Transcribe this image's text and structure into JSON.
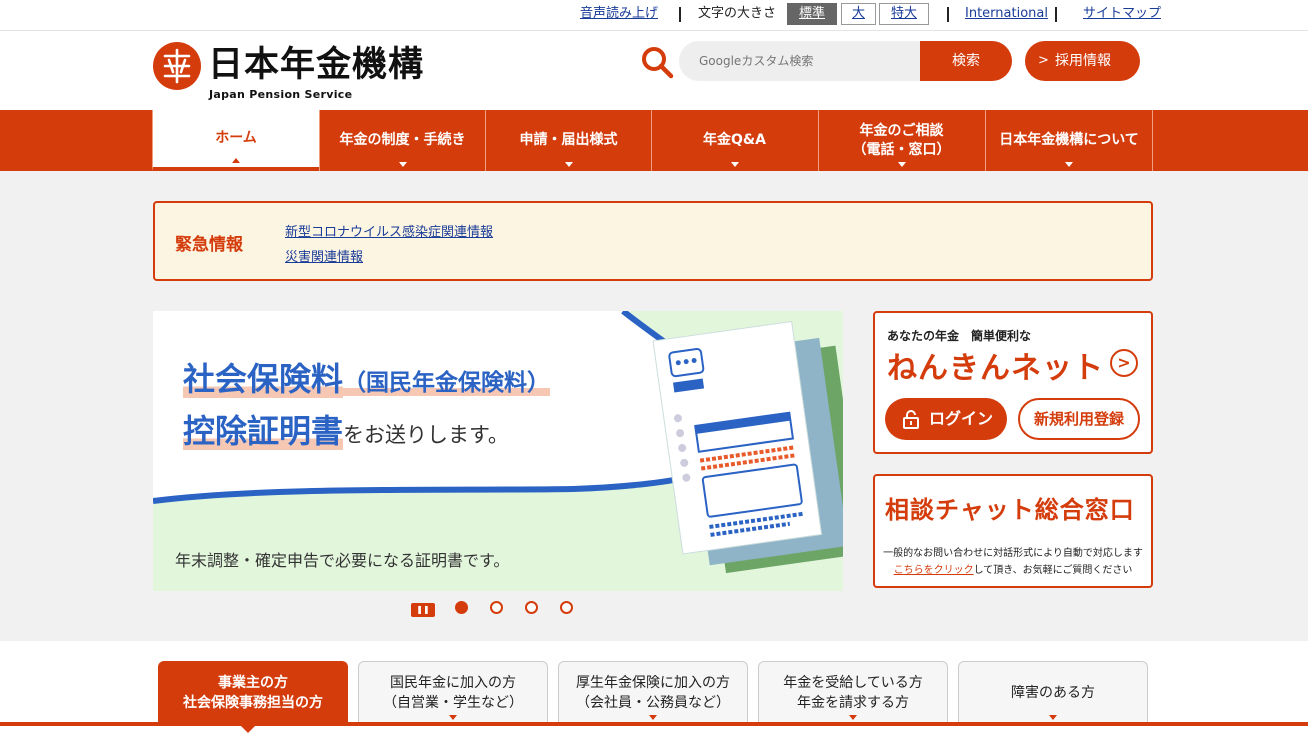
{
  "utility": {
    "voice": "音声読み上げ",
    "font_size_label": "文字の大きさ",
    "font_sizes": [
      "標準",
      "大",
      "特大"
    ],
    "international": "International",
    "sitemap": "サイトマップ"
  },
  "header": {
    "logo_text": "日本年金機構",
    "logo_sub": "Japan Pension Service",
    "search_placeholder": "Googleカスタム検索",
    "search_button": "検索",
    "recruit_button": "採用情報"
  },
  "nav": [
    {
      "label": "ホーム"
    },
    {
      "label": "年金の制度・手続き"
    },
    {
      "label": "申請・届出様式"
    },
    {
      "label": "年金Q&A"
    },
    {
      "label": "年金のご相談\n（電話・窓口）"
    },
    {
      "label": "日本年金機構について"
    }
  ],
  "alert": {
    "title": "緊急情報",
    "links": [
      "新型コロナウイルス感染症関連情報",
      "災害関連情報"
    ]
  },
  "banner": {
    "line1_main": "社会保険料",
    "line1_paren": "（国民年金保険料）",
    "line2_main": "控除証明書",
    "line2_tail": "をお送りします。",
    "footer": "年末調整・確定申告で必要になる証明書です。",
    "slides_total": 4,
    "slide_active": 1
  },
  "nenkin_net": {
    "subtitle": "あなたの年金　簡単便利な",
    "title": "ねんきんネット",
    "login": "ログイン",
    "register": "新規利用登録"
  },
  "chat": {
    "title": "相談チャット総合窓口",
    "desc1": "一般的なお問い合わせに対話形式により自動で対応します",
    "link": "こちらをクリック",
    "desc2": "して頂き、お気軽にご質問ください"
  },
  "audience_tabs": [
    {
      "line1": "事業主の方",
      "line2": "社会保険事務担当の方"
    },
    {
      "line1": "国民年金に加入の方",
      "line2": "（自営業・学生など）"
    },
    {
      "line1": "厚生年金保険に加入の方",
      "line2": "（会社員・公務員など）"
    },
    {
      "line1": "年金を受給している方",
      "line2": "年金を請求する方"
    },
    {
      "line1": "障害のある方",
      "line2": ""
    }
  ],
  "colors": {
    "brand": "#d43c0c",
    "link": "#1a3c99",
    "banner_blue": "#2b63c4"
  }
}
